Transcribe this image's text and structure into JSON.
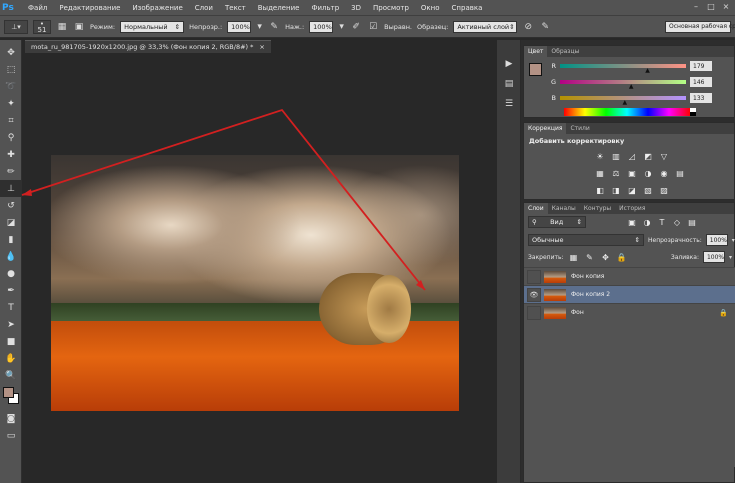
{
  "app": {
    "logo": "Ps"
  },
  "menu": [
    "Файл",
    "Редактирование",
    "Изображение",
    "Слои",
    "Текст",
    "Выделение",
    "Фильтр",
    "3D",
    "Просмотр",
    "Окно",
    "Справка"
  ],
  "window_controls": [
    "–",
    "□",
    "×"
  ],
  "options": {
    "brush_size": "51",
    "mode_label": "Режим:",
    "mode_value": "Нормальный",
    "opacity_label": "Непрозр.:",
    "opacity_value": "100%",
    "pressure_label": "Наж.:",
    "pressure_value": "100%",
    "aligned_label": "Выравн.",
    "sample_label": "Образец:",
    "sample_value": "Активный слой",
    "workspace_value": "Основная рабочая среда"
  },
  "document": {
    "tab_title": "mota_ru_981705-1920x1200.jpg @ 33,3% (Фон копия 2, RGB/8#) *",
    "close": "×"
  },
  "color_panel": {
    "tabs": [
      "Цвет",
      "Образцы"
    ],
    "channels": [
      {
        "label": "R",
        "value": "179",
        "fraction": 0.7
      },
      {
        "label": "G",
        "value": "146",
        "fraction": 0.57
      },
      {
        "label": "B",
        "value": "133",
        "fraction": 0.52
      }
    ],
    "swatch_color": "#b39285"
  },
  "adjust_panel": {
    "tabs": [
      "Коррекция",
      "Стили"
    ],
    "title": "Добавить корректировку"
  },
  "layers_panel": {
    "tabs": [
      "Слои",
      "Каналы",
      "Контуры",
      "История"
    ],
    "filter_value": "Вид",
    "blend_value": "Обычные",
    "opacity_label": "Непрозрачность:",
    "opacity_value": "100%",
    "lock_label": "Закрепить:",
    "fill_label": "Заливка:",
    "fill_value": "100%",
    "layers": [
      {
        "name": "Фон копия",
        "visible": false,
        "selected": false,
        "locked": false
      },
      {
        "name": "Фон копия 2",
        "visible": true,
        "selected": true,
        "locked": false
      },
      {
        "name": "Фон",
        "visible": false,
        "selected": false,
        "locked": true
      }
    ]
  },
  "colors": {
    "foreground": "#b39285",
    "background": "#ffffff",
    "annotation": "#d22020",
    "selection": "#5c6f8d"
  }
}
